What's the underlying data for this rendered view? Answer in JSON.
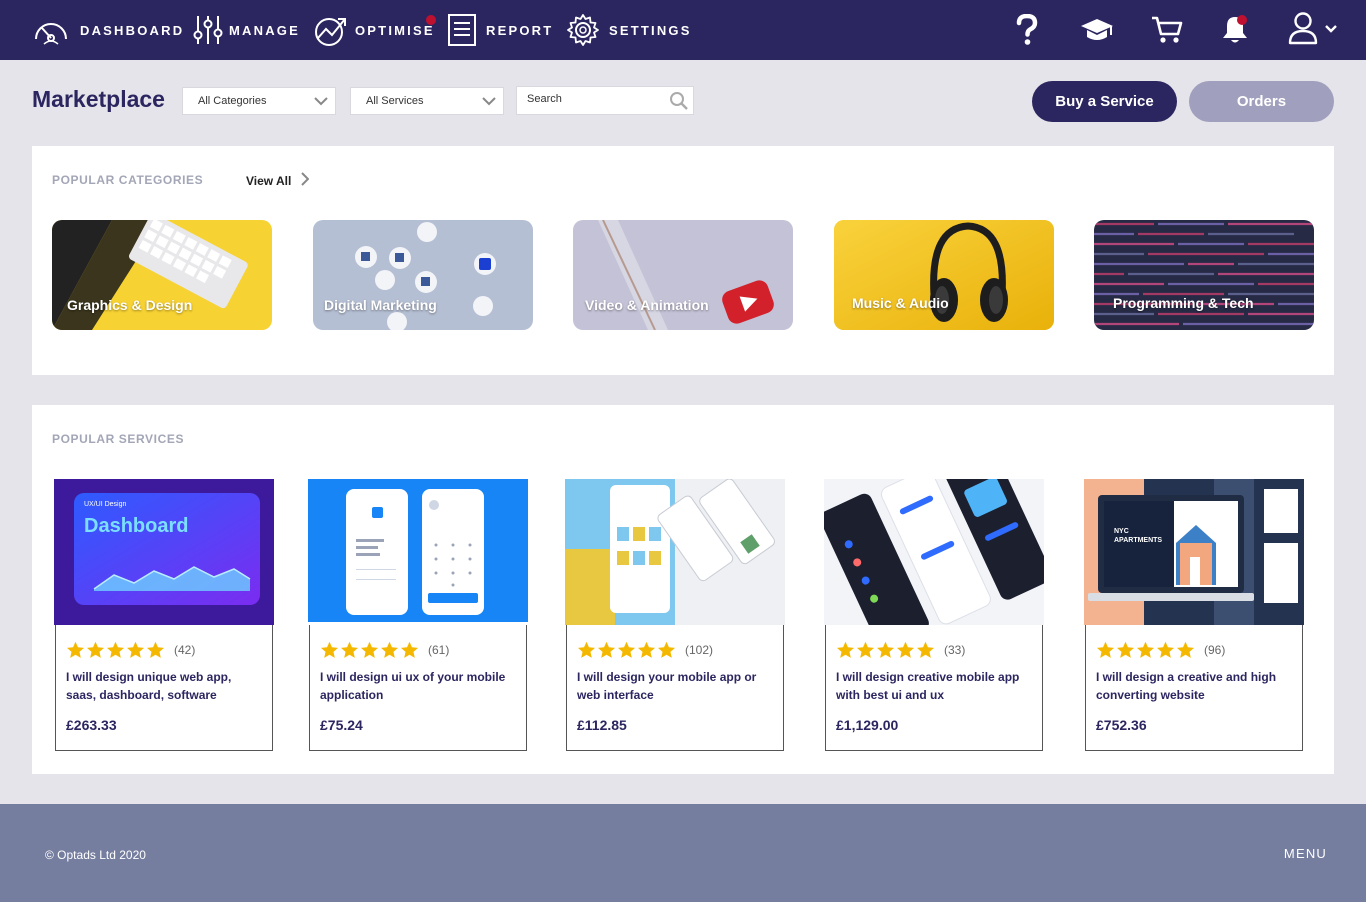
{
  "nav": {
    "items": [
      {
        "label": "DASHBOARD",
        "icon": "speedometer-icon"
      },
      {
        "label": "MANAGE",
        "icon": "sliders-icon"
      },
      {
        "label": "OPTIMISE",
        "icon": "trend-chart-icon"
      },
      {
        "label": "REPORT",
        "icon": "document-icon"
      },
      {
        "label": "SETTINGS",
        "icon": "gear-icon"
      }
    ],
    "right_icons": [
      "help-icon",
      "graduation-cap-icon",
      "cart-icon",
      "bell-icon",
      "user-icon"
    ],
    "accent_dot_color": "#c0102f"
  },
  "toolbar": {
    "title": "Marketplace",
    "category_select": "All Categories",
    "services_select": "All Services",
    "search_placeholder": "Search",
    "buy_label": "Buy a Service",
    "orders_label": "Orders"
  },
  "categories": {
    "title": "POPULAR CATEGORIES",
    "view_all": "View All",
    "items": [
      {
        "label": "Graphics & Design"
      },
      {
        "label": "Digital Marketing"
      },
      {
        "label": "Video & Animation"
      },
      {
        "label": "Music & Audio"
      },
      {
        "label": "Programming & Tech"
      }
    ]
  },
  "services": {
    "title": "POPULAR SERVICES",
    "items": [
      {
        "rating_count": "(42)",
        "title": "I will design unique web app, saas, dashboard, software",
        "price": "£263.33",
        "thumb_text": "Dashboard",
        "thumb_caption": "UX/UI Design"
      },
      {
        "rating_count": "(61)",
        "title": "I will design ui ux of your mobile application",
        "price": "£75.24"
      },
      {
        "rating_count": "(102)",
        "title": "I will design your mobile app or web interface",
        "price": "£112.85"
      },
      {
        "rating_count": "(33)",
        "title": "I will design creative mobile app with best ui and ux",
        "price": "£1,129.00"
      },
      {
        "rating_count": "(96)",
        "title": "I will design a creative and high converting website",
        "price": "£752.36",
        "thumb_text": "NYC APARTMENTS"
      }
    ]
  },
  "footer": {
    "copyright": "© Optads Ltd 2020",
    "menu": "MENU"
  },
  "colors": {
    "brand": "#2c2660",
    "star": "#f5b800",
    "footer": "#767ea0"
  }
}
